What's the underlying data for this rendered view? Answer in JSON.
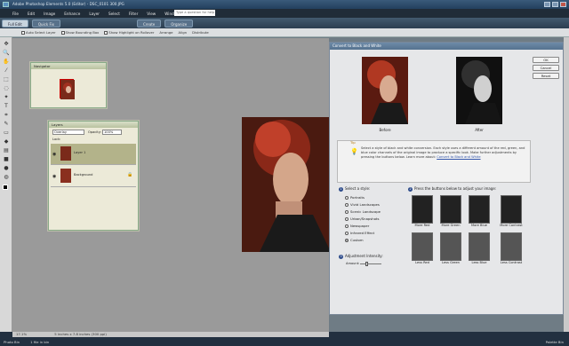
{
  "title": "Adobe Photoshop Elements 5.0 (Editor) - DSC_0101 300.JPG",
  "menu": [
    "File",
    "Edit",
    "Image",
    "Enhance",
    "Layer",
    "Select",
    "Filter",
    "View",
    "Window",
    "Help"
  ],
  "help_placeholder": "Type a question for help",
  "modes": {
    "full_edit": "Full Edit",
    "quick_fix": "Quick Fix",
    "create": "Create",
    "organize": "Organize"
  },
  "options": {
    "auto_select": "Auto Select Layer",
    "bounding": "Show Bounding Box",
    "highlight": "Show Highlight on Rollover",
    "arrange": "Arrange",
    "align": "Align",
    "distribute": "Distribute"
  },
  "navigator": {
    "title": "Navigator"
  },
  "layers": {
    "title": "Layers",
    "blend": "Overlay",
    "opacity_label": "Opacity:",
    "opacity": "100%",
    "lock_label": "Lock:",
    "rows": [
      {
        "name": "Layer 1"
      },
      {
        "name": "Background"
      }
    ]
  },
  "dialog": {
    "title": "Convert to Black and White",
    "ok": "OK",
    "cancel": "Cancel",
    "reset": "Reset",
    "before": "Before",
    "after": "After",
    "tip_label": "Tip",
    "tip_text": "Select a style of black and white conversion. Each style uses a different amount of the red, green, and blue color channels of the original image to produce a specific look. Make further adjustments by pressing the buttons below.",
    "learn_more": "Learn more about:",
    "learn_link": "Convert to Black and White",
    "step1": "Select a style:",
    "styles": [
      "Portraits",
      "Vivid Landscapes",
      "Scenic Landscape",
      "Urban/Snapshots",
      "Newspaper",
      "Infrared Effect",
      "Custom"
    ],
    "selected_style": "Custom",
    "step2": "Press the buttons below to adjust your image:",
    "more": [
      "More Red",
      "More Green",
      "More Blue",
      "More Contrast"
    ],
    "less": [
      "Less Red",
      "Less Green",
      "Less Blue",
      "Less Contrast"
    ],
    "step3": "Adjustment Intensity:",
    "amount": "Amount:"
  },
  "status": {
    "zoom": "17.1%",
    "docinfo": "5 inches x 7.8 inches (300 ppi)",
    "photo_bin": "Photo Bin",
    "bin_info": "1 file in bin",
    "palette_bin": "Palette Bin"
  }
}
